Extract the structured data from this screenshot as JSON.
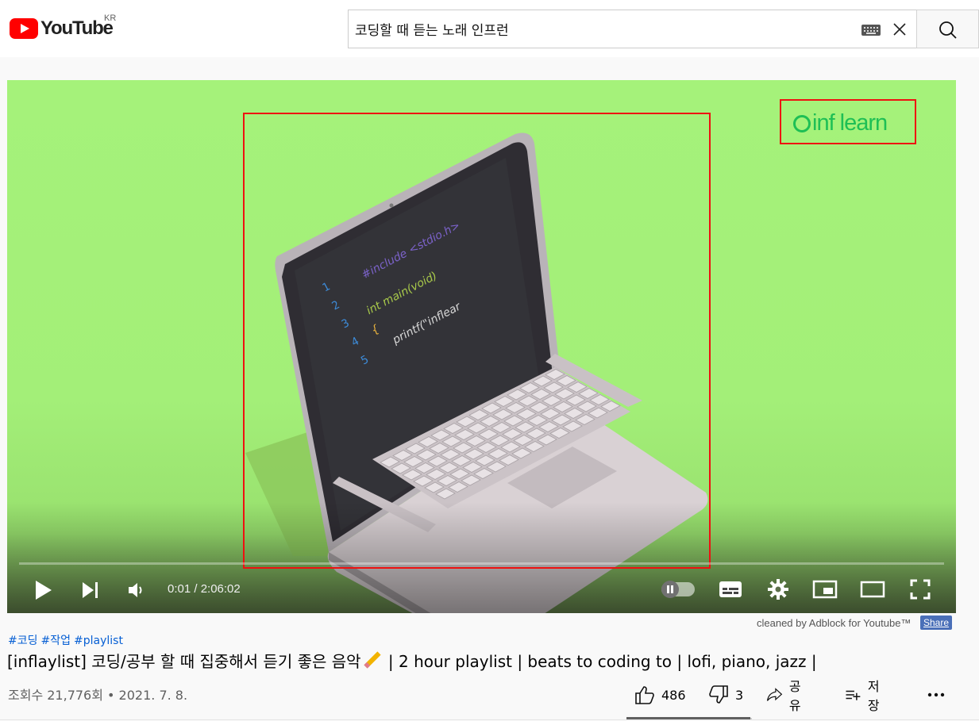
{
  "header": {
    "logo_text": "YouTube",
    "region": "KR",
    "search_query": "코딩할 때 듣는 노래 인프런",
    "icons": [
      "keyboard-icon",
      "clear-icon",
      "search-icon"
    ]
  },
  "player": {
    "brand_text": "inf learn",
    "screen_code": {
      "line_numbers": [
        "1",
        "2",
        "3",
        "4",
        "5"
      ],
      "include_line": "#include <stdio.h>",
      "main_line": "int  main(void)",
      "brace": "{",
      "printf_line": "printf(\"inflear"
    },
    "time_display": "0:01 / 2:06:02",
    "progress": 0.0001
  },
  "below": {
    "adblock_text": "cleaned by Adblock for Youtube™",
    "share_badge": "Share",
    "hashtags": [
      "#코딩",
      "#작업",
      "#playlist"
    ],
    "title_part1": "[inflaylist] 코딩/공부 할 때 집중해서 듣기 좋은 음악",
    "title_part2": " | 2 hour playlist | beats to coding to | lofi, piano, jazz |",
    "meta": "조회수 21,776회 • 2021. 7. 8.",
    "like_count": "486",
    "dislike_count": "3",
    "share_label": "공유",
    "save_label": "저장"
  },
  "colors": {
    "brand_red": "#ff0000",
    "video_bg": "#a5f27a",
    "link_blue": "#065fd4",
    "annotation_red": "#ee1111"
  }
}
